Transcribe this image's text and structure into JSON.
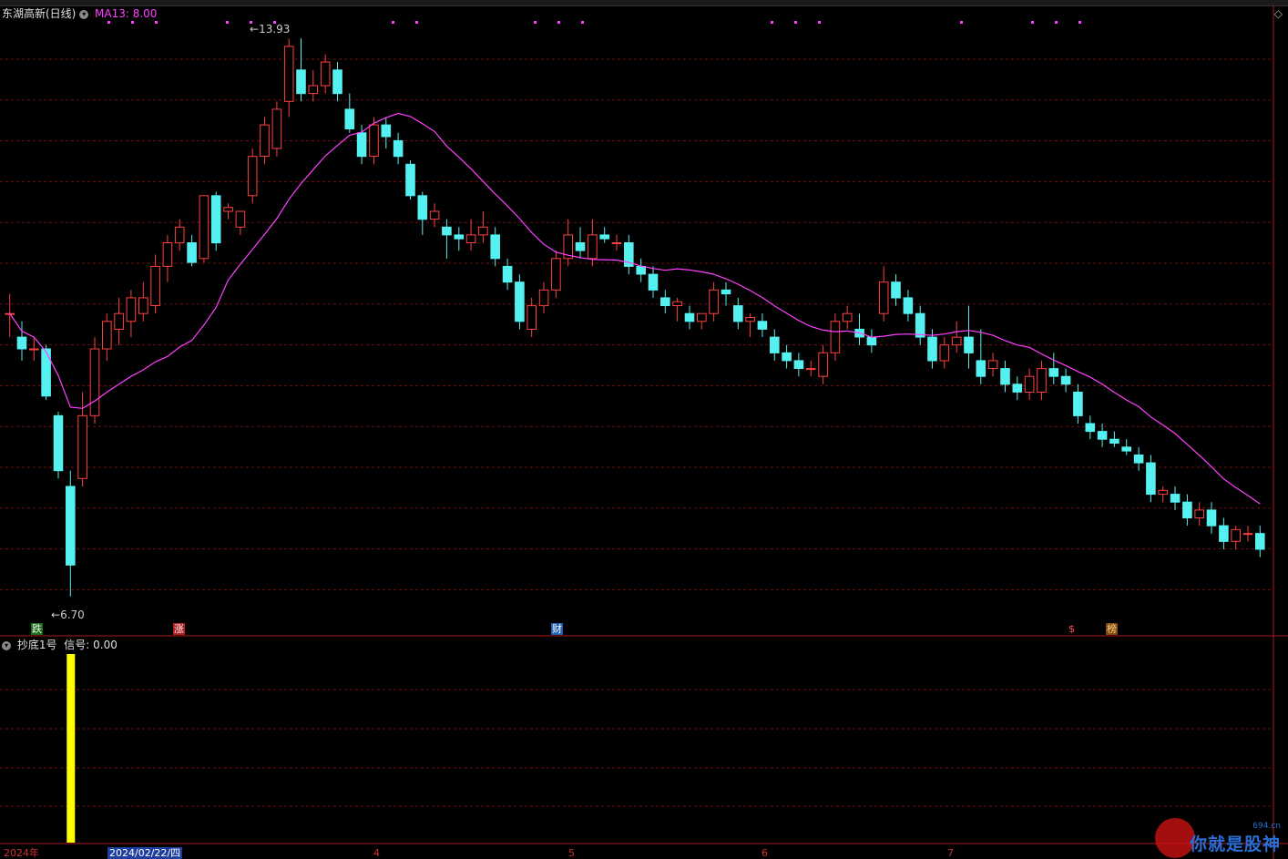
{
  "header": {
    "stock_title": "东湖高新(日线)",
    "ma_label": "MA13: 8.00",
    "collapse_icon": "chevron-down-icon"
  },
  "price_panel": {
    "high_label": "13.93",
    "low_label": "6.70",
    "high_value": 13.93,
    "low_value": 6.7,
    "tags": [
      {
        "text": "跌",
        "color": "#f0f0f0",
        "bg": "#1a6e1a"
      },
      {
        "text": "涨",
        "color": "#f0f0f0",
        "bg": "#b02020"
      },
      {
        "text": "财",
        "color": "#ffffff",
        "bg": "#1f5fb0"
      },
      {
        "text": "$",
        "color": "#ff5050",
        "bg": "#000000"
      },
      {
        "text": "榜",
        "color": "#ffd080",
        "bg": "#7a4a10"
      }
    ]
  },
  "indicator_panel": {
    "title": "抄底1号",
    "signal_label": "信号: 0.00",
    "signal_bar_color": "#ffff00"
  },
  "x_axis": {
    "labels": [
      "2024年",
      "2024/02/22/四",
      "4",
      "5",
      "6",
      "7"
    ]
  },
  "watermark": {
    "text": "你就是股神",
    "domain": "694.cn"
  },
  "colors": {
    "up": "#ff4040",
    "down": "#55f0f0",
    "ma": "#ff40ff",
    "grid": "#6e1010"
  },
  "chart_data": {
    "type": "candlestick",
    "title": "东湖高新(日线)",
    "series": [
      {
        "name": "MA13"
      }
    ],
    "ma13_last": 8.0,
    "y_range_visible": [
      6.7,
      13.93
    ],
    "candles": [
      [
        10.3,
        10.3,
        10.55,
        10.0
      ],
      [
        10.0,
        9.85,
        10.2,
        9.7
      ],
      [
        9.85,
        9.85,
        10.0,
        9.7
      ],
      [
        9.85,
        9.25,
        9.9,
        9.2
      ],
      [
        9.0,
        8.3,
        9.05,
        8.2
      ],
      [
        8.1,
        7.1,
        8.3,
        6.7
      ],
      [
        8.2,
        9.0,
        9.3,
        8.1
      ],
      [
        9.0,
        9.85,
        10.0,
        8.9
      ],
      [
        9.85,
        10.2,
        10.3,
        9.7
      ],
      [
        10.1,
        10.3,
        10.5,
        9.9
      ],
      [
        10.2,
        10.5,
        10.6,
        10.0
      ],
      [
        10.3,
        10.5,
        10.7,
        10.2
      ],
      [
        10.4,
        10.9,
        11.05,
        10.3
      ],
      [
        10.9,
        11.2,
        11.3,
        10.7
      ],
      [
        11.2,
        11.4,
        11.5,
        11.1
      ],
      [
        11.2,
        10.95,
        11.3,
        10.9
      ],
      [
        11.0,
        11.8,
        11.8,
        10.95
      ],
      [
        11.8,
        11.2,
        11.85,
        11.1
      ],
      [
        11.6,
        11.65,
        11.7,
        11.5
      ],
      [
        11.4,
        11.6,
        11.6,
        11.3
      ],
      [
        11.8,
        12.3,
        12.4,
        11.7
      ],
      [
        12.3,
        12.7,
        12.8,
        12.2
      ],
      [
        12.4,
        12.9,
        13.0,
        12.3
      ],
      [
        13.0,
        13.7,
        13.8,
        12.8
      ],
      [
        13.4,
        13.1,
        13.8,
        13.0
      ],
      [
        13.1,
        13.2,
        13.4,
        13.0
      ],
      [
        13.2,
        13.5,
        13.6,
        13.1
      ],
      [
        13.4,
        13.1,
        13.5,
        13.0
      ],
      [
        12.9,
        12.65,
        13.1,
        12.6
      ],
      [
        12.6,
        12.3,
        12.7,
        12.2
      ],
      [
        12.3,
        12.7,
        12.8,
        12.2
      ],
      [
        12.7,
        12.55,
        12.8,
        12.4
      ],
      [
        12.5,
        12.3,
        12.6,
        12.2
      ],
      [
        12.2,
        11.8,
        12.25,
        11.75
      ],
      [
        11.8,
        11.5,
        11.85,
        11.3
      ],
      [
        11.5,
        11.6,
        11.7,
        11.4
      ],
      [
        11.4,
        11.3,
        11.5,
        11.0
      ],
      [
        11.3,
        11.25,
        11.4,
        11.1
      ],
      [
        11.2,
        11.3,
        11.5,
        11.1
      ],
      [
        11.3,
        11.4,
        11.6,
        11.2
      ],
      [
        11.3,
        11.0,
        11.4,
        10.9
      ],
      [
        10.9,
        10.7,
        11.0,
        10.6
      ],
      [
        10.7,
        10.2,
        10.8,
        10.1
      ],
      [
        10.1,
        10.4,
        10.5,
        10.0
      ],
      [
        10.4,
        10.6,
        10.7,
        10.3
      ],
      [
        10.6,
        11.0,
        11.1,
        10.5
      ],
      [
        11.0,
        11.3,
        11.5,
        10.9
      ],
      [
        11.2,
        11.1,
        11.4,
        11.0
      ],
      [
        11.0,
        11.3,
        11.5,
        10.9
      ],
      [
        11.3,
        11.25,
        11.4,
        11.2
      ],
      [
        11.2,
        11.2,
        11.3,
        11.1
      ],
      [
        11.2,
        10.9,
        11.3,
        10.8
      ],
      [
        10.9,
        10.8,
        11.0,
        10.7
      ],
      [
        10.8,
        10.6,
        10.9,
        10.5
      ],
      [
        10.5,
        10.4,
        10.6,
        10.3
      ],
      [
        10.4,
        10.45,
        10.5,
        10.2
      ],
      [
        10.3,
        10.2,
        10.4,
        10.1
      ],
      [
        10.2,
        10.3,
        10.3,
        10.1
      ],
      [
        10.3,
        10.6,
        10.7,
        10.2
      ],
      [
        10.6,
        10.55,
        10.7,
        10.4
      ],
      [
        10.4,
        10.2,
        10.5,
        10.1
      ],
      [
        10.2,
        10.25,
        10.3,
        10.0
      ],
      [
        10.2,
        10.1,
        10.3,
        10.0
      ],
      [
        10.0,
        9.8,
        10.1,
        9.7
      ],
      [
        9.8,
        9.7,
        9.9,
        9.6
      ],
      [
        9.7,
        9.6,
        9.8,
        9.5
      ],
      [
        9.6,
        9.6,
        9.7,
        9.5
      ],
      [
        9.5,
        9.8,
        9.9,
        9.4
      ],
      [
        9.8,
        10.2,
        10.3,
        9.7
      ],
      [
        10.2,
        10.3,
        10.4,
        10.1
      ],
      [
        10.1,
        10.0,
        10.3,
        9.9
      ],
      [
        10.0,
        9.9,
        10.1,
        9.8
      ],
      [
        10.3,
        10.7,
        10.9,
        10.2
      ],
      [
        10.7,
        10.5,
        10.8,
        10.4
      ],
      [
        10.5,
        10.3,
        10.6,
        10.2
      ],
      [
        10.3,
        10.0,
        10.4,
        9.9
      ],
      [
        10.0,
        9.7,
        10.1,
        9.6
      ],
      [
        9.7,
        9.9,
        10.0,
        9.6
      ],
      [
        9.9,
        10.0,
        10.2,
        9.8
      ],
      [
        10.0,
        9.8,
        10.4,
        9.6
      ],
      [
        9.7,
        9.5,
        10.1,
        9.4
      ],
      [
        9.6,
        9.7,
        9.8,
        9.5
      ],
      [
        9.6,
        9.4,
        9.7,
        9.3
      ],
      [
        9.4,
        9.3,
        9.5,
        9.2
      ],
      [
        9.3,
        9.5,
        9.6,
        9.2
      ],
      [
        9.3,
        9.6,
        9.7,
        9.2
      ],
      [
        9.6,
        9.5,
        9.8,
        9.4
      ],
      [
        9.5,
        9.4,
        9.6,
        9.3
      ],
      [
        9.3,
        9.0,
        9.4,
        8.9
      ],
      [
        8.9,
        8.8,
        9.0,
        8.7
      ],
      [
        8.8,
        8.7,
        8.9,
        8.6
      ],
      [
        8.7,
        8.65,
        8.8,
        8.6
      ],
      [
        8.6,
        8.55,
        8.7,
        8.5
      ],
      [
        8.5,
        8.4,
        8.6,
        8.3
      ],
      [
        8.4,
        8.0,
        8.5,
        7.9
      ],
      [
        8.0,
        8.05,
        8.1,
        7.9
      ],
      [
        8.0,
        7.9,
        8.1,
        7.8
      ],
      [
        7.9,
        7.7,
        8.0,
        7.6
      ],
      [
        7.7,
        7.8,
        7.9,
        7.6
      ],
      [
        7.8,
        7.6,
        7.9,
        7.5
      ],
      [
        7.6,
        7.4,
        7.7,
        7.3
      ],
      [
        7.4,
        7.55,
        7.6,
        7.3
      ],
      [
        7.5,
        7.5,
        7.6,
        7.4
      ],
      [
        7.5,
        7.3,
        7.6,
        7.2
      ]
    ]
  }
}
